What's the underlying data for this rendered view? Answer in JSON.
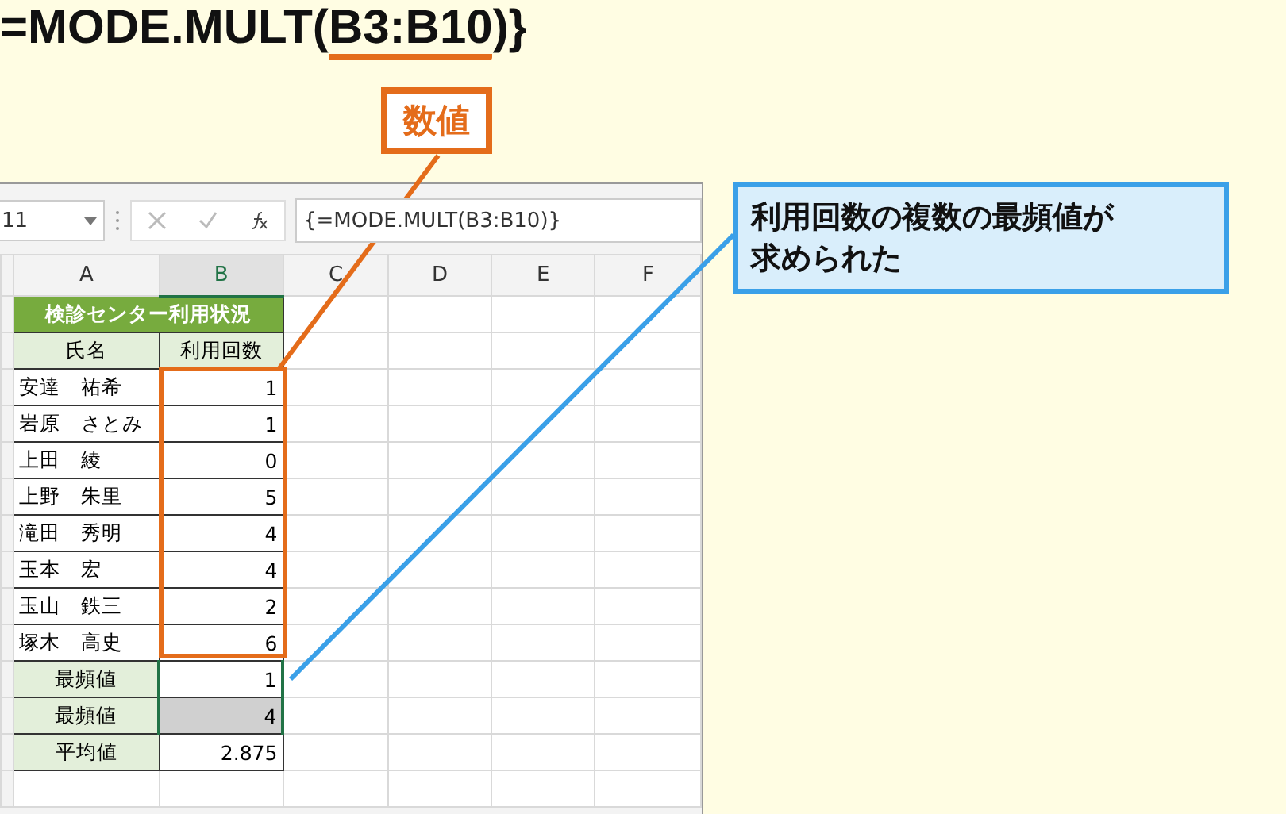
{
  "heading": {
    "before": "=MODE.MULT(",
    "range": "B3:B10",
    "after": ")}"
  },
  "label_callout": {
    "text": "数値"
  },
  "note_callout": {
    "lines": [
      "利用回数の複数の最頻値が",
      "求められた"
    ]
  },
  "formula_bar": {
    "name_box": "11",
    "formula": "{=MODE.MULT(B3:B10)}"
  },
  "columns": [
    {
      "label": "A",
      "selected": false
    },
    {
      "label": "B",
      "selected": true
    },
    {
      "label": "C",
      "selected": false
    },
    {
      "label": "D",
      "selected": false
    },
    {
      "label": "E",
      "selected": false
    },
    {
      "label": "F",
      "selected": false
    }
  ],
  "rows": [
    {
      "kind": "title",
      "a": "検診センター利用状況"
    },
    {
      "kind": "header",
      "a": "氏名",
      "b": "利用回数"
    },
    {
      "kind": "data",
      "a": "安達　祐希",
      "b": "1"
    },
    {
      "kind": "data",
      "a": "岩原　さとみ",
      "b": "1"
    },
    {
      "kind": "data",
      "a": "上田　綾",
      "b": "0"
    },
    {
      "kind": "data",
      "a": "上野　朱里",
      "b": "5"
    },
    {
      "kind": "data",
      "a": "滝田　秀明",
      "b": "4"
    },
    {
      "kind": "data",
      "a": "玉本　宏",
      "b": "4"
    },
    {
      "kind": "data",
      "a": "玉山　鉄三",
      "b": "2"
    },
    {
      "kind": "data",
      "a": "塚木　高史",
      "b": "6"
    },
    {
      "kind": "summary",
      "a": "最頻値",
      "b": "1",
      "selected": true,
      "shaded": false
    },
    {
      "kind": "summary",
      "a": "最頻値",
      "b": "4",
      "selected": true,
      "shaded": true
    },
    {
      "kind": "summary",
      "a": "平均値",
      "b": "2.875",
      "selected": false,
      "shaded": false
    },
    {
      "kind": "empty"
    }
  ]
}
